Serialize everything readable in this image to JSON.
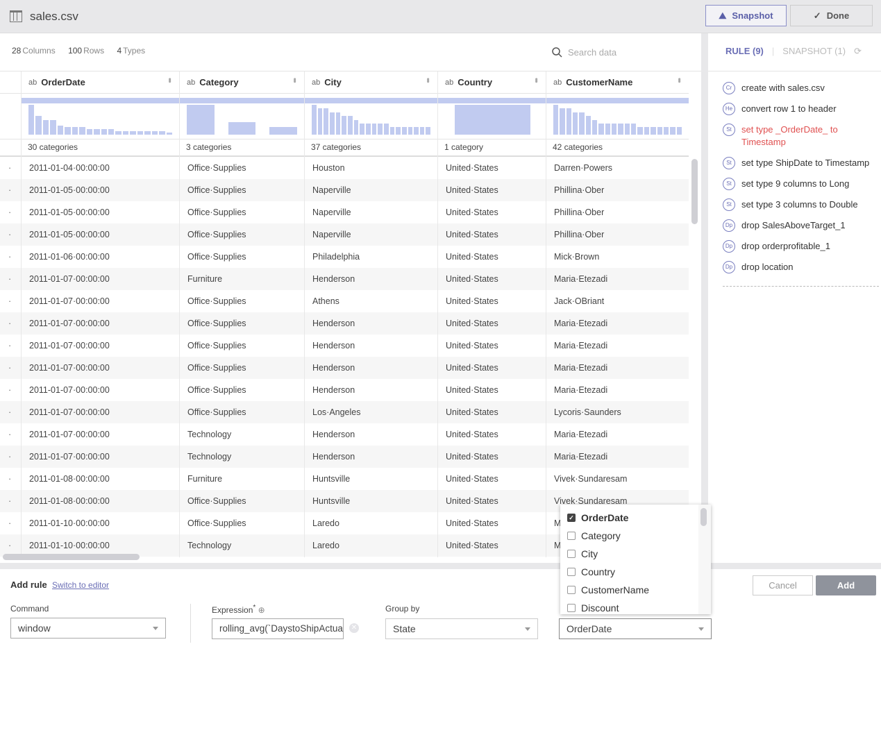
{
  "header": {
    "title": "sales.csv",
    "snapshot_label": "Snapshot",
    "done_label": "Done"
  },
  "stats": {
    "columns": "28",
    "columns_label": "Columns",
    "rows": "100",
    "rows_label": "Rows",
    "types": "4",
    "types_label": "Types"
  },
  "search": {
    "placeholder": "Search data"
  },
  "columns": [
    {
      "type": "ab",
      "name": "OrderDate",
      "categories": "30 categories",
      "histogram": [
        16,
        10,
        8,
        8,
        5,
        4,
        4,
        4,
        3,
        3,
        3,
        3,
        2,
        2,
        2,
        2,
        2,
        2,
        2,
        1
      ]
    },
    {
      "type": "ab",
      "name": "Category",
      "categories": "3 categories",
      "histogram": [
        60,
        25,
        15
      ]
    },
    {
      "type": "ab",
      "name": "City",
      "categories": "37 categories",
      "histogram": [
        8,
        7,
        7,
        6,
        6,
        5,
        5,
        4,
        3,
        3,
        3,
        3,
        3,
        2,
        2,
        2,
        2,
        2,
        2,
        2
      ]
    },
    {
      "type": "ab",
      "name": "Country",
      "categories": "1 category",
      "histogram": [
        100
      ]
    },
    {
      "type": "ab",
      "name": "CustomerName",
      "categories": "42 categories",
      "histogram": [
        8,
        7,
        7,
        6,
        6,
        5,
        4,
        3,
        3,
        3,
        3,
        3,
        3,
        2,
        2,
        2,
        2,
        2,
        2,
        2
      ]
    }
  ],
  "rows": [
    [
      "2011-01-04·00:00:00",
      "Office·Supplies",
      "Houston",
      "United·States",
      "Darren·Powers"
    ],
    [
      "2011-01-05·00:00:00",
      "Office·Supplies",
      "Naperville",
      "United·States",
      "Phillina·Ober"
    ],
    [
      "2011-01-05·00:00:00",
      "Office·Supplies",
      "Naperville",
      "United·States",
      "Phillina·Ober"
    ],
    [
      "2011-01-05·00:00:00",
      "Office·Supplies",
      "Naperville",
      "United·States",
      "Phillina·Ober"
    ],
    [
      "2011-01-06·00:00:00",
      "Office·Supplies",
      "Philadelphia",
      "United·States",
      "Mick·Brown"
    ],
    [
      "2011-01-07·00:00:00",
      "Furniture",
      "Henderson",
      "United·States",
      "Maria·Etezadi"
    ],
    [
      "2011-01-07·00:00:00",
      "Office·Supplies",
      "Athens",
      "United·States",
      "Jack·OBriant"
    ],
    [
      "2011-01-07·00:00:00",
      "Office·Supplies",
      "Henderson",
      "United·States",
      "Maria·Etezadi"
    ],
    [
      "2011-01-07·00:00:00",
      "Office·Supplies",
      "Henderson",
      "United·States",
      "Maria·Etezadi"
    ],
    [
      "2011-01-07·00:00:00",
      "Office·Supplies",
      "Henderson",
      "United·States",
      "Maria·Etezadi"
    ],
    [
      "2011-01-07·00:00:00",
      "Office·Supplies",
      "Henderson",
      "United·States",
      "Maria·Etezadi"
    ],
    [
      "2011-01-07·00:00:00",
      "Office·Supplies",
      "Los·Angeles",
      "United·States",
      "Lycoris·Saunders"
    ],
    [
      "2011-01-07·00:00:00",
      "Technology",
      "Henderson",
      "United·States",
      "Maria·Etezadi"
    ],
    [
      "2011-01-07·00:00:00",
      "Technology",
      "Henderson",
      "United·States",
      "Maria·Etezadi"
    ],
    [
      "2011-01-08·00:00:00",
      "Furniture",
      "Huntsville",
      "United·States",
      "Vivek·Sundaresam"
    ],
    [
      "2011-01-08·00:00:00",
      "Office·Supplies",
      "Huntsville",
      "United·States",
      "Vivek·Sundaresam"
    ],
    [
      "2011-01-10·00:00:00",
      "Office·Supplies",
      "Laredo",
      "United·States",
      "M"
    ],
    [
      "2011-01-10·00:00:00",
      "Technology",
      "Laredo",
      "United·States",
      "M"
    ]
  ],
  "right_panel": {
    "rule_tab": "RULE (9)",
    "snapshot_tab": "SNAPSHOT (1)",
    "rules": [
      {
        "badge": "Cr",
        "text": "create with sales.csv",
        "error": false
      },
      {
        "badge": "He",
        "text": "convert row 1 to header",
        "error": false
      },
      {
        "badge": "St",
        "text": "set type _OrderDate_ to Timestamp",
        "error": true
      },
      {
        "badge": "St",
        "text": "set type ShipDate to Timestamp",
        "error": false
      },
      {
        "badge": "St",
        "text": "set type 9 columns to Long",
        "error": false
      },
      {
        "badge": "St",
        "text": "set type 3 columns to Double",
        "error": false
      },
      {
        "badge": "Dp",
        "text": "drop SalesAboveTarget_1",
        "error": false
      },
      {
        "badge": "Dp",
        "text": "drop orderprofitable_1",
        "error": false
      },
      {
        "badge": "Dp",
        "text": "drop location",
        "error": false
      }
    ]
  },
  "add_rule": {
    "title": "Add rule",
    "switch_label": "Switch to editor",
    "command_label": "Command",
    "command_value": "window",
    "expression_label": "Expression",
    "expression_required": "*",
    "expression_value": "rolling_avg(`DaystoShipActua",
    "group_by_label": "Group by",
    "group_by_value": "State",
    "order_by_value": "OrderDate",
    "order_options": [
      {
        "label": "OrderDate",
        "checked": true
      },
      {
        "label": "Category",
        "checked": false
      },
      {
        "label": "City",
        "checked": false
      },
      {
        "label": "Country",
        "checked": false
      },
      {
        "label": "CustomerName",
        "checked": false
      },
      {
        "label": "Discount",
        "checked": false
      }
    ],
    "cancel_label": "Cancel",
    "add_label": "Add"
  },
  "colors": {
    "accent": "#6a6eb5",
    "histogram": "#c1cbf0",
    "error": "#e05050"
  }
}
